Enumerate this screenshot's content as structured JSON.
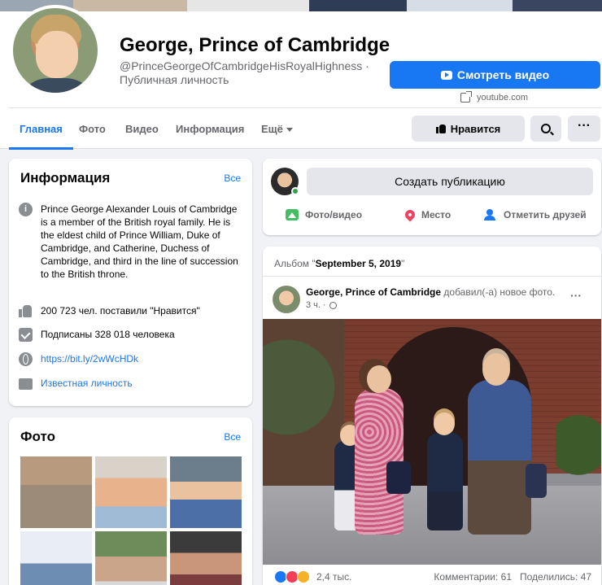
{
  "page": {
    "name": "George, Prince of Cambridge",
    "handle": "@PrinceGeorgeOfCambridgeHisRoyalHighness ·",
    "category": "Публичная личность",
    "watch_button": "Смотреть видео",
    "external_link": "youtube.com"
  },
  "tabs": [
    {
      "label": "Главная",
      "active": true
    },
    {
      "label": "Фото"
    },
    {
      "label": "Видео"
    },
    {
      "label": "Информация"
    },
    {
      "label": "Ещё"
    }
  ],
  "actions": {
    "like": "Нравится",
    "more": "···"
  },
  "info": {
    "title": "Информация",
    "see_all": "Все",
    "about": "Prince George Alexander Louis of Cambridge is a member of the British royal family. He is the eldest child of Prince William, Duke of Cambridge, and Catherine, Duchess of Cambridge, and third in the line of succession to the British throne.",
    "likes": "200 723 чел. поставили \"Нравится\"",
    "follows": "Подписаны 328 018 человека",
    "link": "https://bit.ly/2wWcHDk",
    "category": "Известная личность"
  },
  "photos": {
    "title": "Фото",
    "see_all": "Все"
  },
  "composer": {
    "placeholder": "Создать публикацию",
    "photo_video": "Фото/видео",
    "location": "Место",
    "tag_friends": "Отметить друзей"
  },
  "album": {
    "prefix": "Альбом \"",
    "name": "September 5, 2019",
    "suffix": "\""
  },
  "post": {
    "author": "George, Prince of Cambridge",
    "action": "добавил(-а) новое фото.",
    "time": "3 ч. ·",
    "more": "···",
    "reactions_count": "2,4 тыс.",
    "comments": "Комментарии: 61",
    "shares": "Поделились: 47"
  },
  "colors": {
    "accent": "#1877f2",
    "background": "#f0f2f5"
  }
}
